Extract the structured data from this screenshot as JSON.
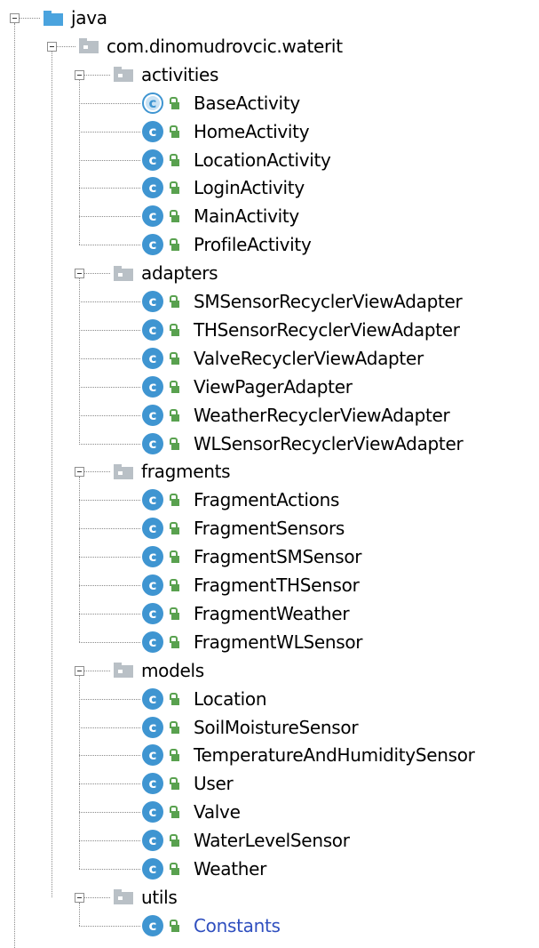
{
  "colors": {
    "class_icon": "#3f95d1",
    "access_lock": "#59a14f",
    "package_folder": "#b9c0c6",
    "source_folder": "#4aa3de",
    "highlight_text": "#2f4fbf"
  },
  "tree": {
    "root": {
      "label": "java",
      "icon": "source-folder-icon"
    },
    "package": {
      "label": "com.dinomudrovcic.waterit",
      "icon": "package-folder-icon"
    },
    "groups": [
      {
        "label": "activities",
        "icon": "package-folder-icon",
        "items": [
          {
            "label": "BaseActivity",
            "icon": "abstract-class-icon"
          },
          {
            "label": "HomeActivity",
            "icon": "class-icon"
          },
          {
            "label": "LocationActivity",
            "icon": "class-icon"
          },
          {
            "label": "LoginActivity",
            "icon": "class-icon"
          },
          {
            "label": "MainActivity",
            "icon": "class-icon"
          },
          {
            "label": "ProfileActivity",
            "icon": "class-icon"
          }
        ]
      },
      {
        "label": "adapters",
        "icon": "package-folder-icon",
        "items": [
          {
            "label": "SMSensorRecyclerViewAdapter",
            "icon": "class-icon"
          },
          {
            "label": "THSensorRecyclerViewAdapter",
            "icon": "class-icon"
          },
          {
            "label": "ValveRecyclerViewAdapter",
            "icon": "class-icon"
          },
          {
            "label": "ViewPagerAdapter",
            "icon": "class-icon"
          },
          {
            "label": "WeatherRecyclerViewAdapter",
            "icon": "class-icon"
          },
          {
            "label": "WLSensorRecyclerViewAdapter",
            "icon": "class-icon"
          }
        ]
      },
      {
        "label": "fragments",
        "icon": "package-folder-icon",
        "items": [
          {
            "label": "FragmentActions",
            "icon": "class-icon"
          },
          {
            "label": "FragmentSensors",
            "icon": "class-icon"
          },
          {
            "label": "FragmentSMSensor",
            "icon": "class-icon"
          },
          {
            "label": "FragmentTHSensor",
            "icon": "class-icon"
          },
          {
            "label": "FragmentWeather",
            "icon": "class-icon"
          },
          {
            "label": "FragmentWLSensor",
            "icon": "class-icon"
          }
        ]
      },
      {
        "label": "models",
        "icon": "package-folder-icon",
        "items": [
          {
            "label": "Location",
            "icon": "class-icon"
          },
          {
            "label": "SoilMoistureSensor",
            "icon": "class-icon"
          },
          {
            "label": "TemperatureAndHumiditySensor",
            "icon": "class-icon"
          },
          {
            "label": "User",
            "icon": "class-icon"
          },
          {
            "label": "Valve",
            "icon": "class-icon"
          },
          {
            "label": "WaterLevelSensor",
            "icon": "class-icon"
          },
          {
            "label": "Weather",
            "icon": "class-icon"
          }
        ]
      },
      {
        "label": "utils",
        "icon": "package-folder-icon",
        "items": [
          {
            "label": "Constants",
            "icon": "class-icon",
            "highlighted": true
          }
        ]
      }
    ]
  }
}
